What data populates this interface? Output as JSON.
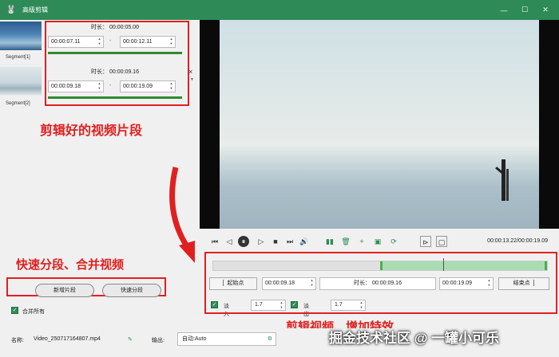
{
  "window": {
    "title": "高级剪辑",
    "app_icon": "rabbit-icon",
    "controls": [
      "minimize-icon",
      "maximize-icon",
      "close-icon"
    ]
  },
  "segments": [
    {
      "label": "Segment[1]",
      "duration_label": "时长：",
      "duration": "00:00:05.00",
      "start": "00:00:07.11",
      "end": "00:00:12.11",
      "separator": "-",
      "progress": 1.0
    },
    {
      "label": "Segment[2]",
      "duration_label": "时长：",
      "duration": "00:00:09.16",
      "start": "00:00:09.18",
      "end": "00:00:19.09",
      "separator": "-",
      "progress": 1.0
    }
  ],
  "segment_close": "×",
  "actions": {
    "add_segment": "新增片段",
    "quick_split": "快速分段",
    "merge_all_label": "合并所有",
    "merge_all_checked": true
  },
  "player": {
    "time_current": "00:00:13.22",
    "time_total": "00:00:19.09",
    "time_separator": "/",
    "controls": [
      "skip-start-icon",
      "step-back-icon",
      "pause-icon",
      "step-forward-icon",
      "skip-end-icon",
      "volume-icon",
      "split-icon",
      "delete-icon",
      "add-icon",
      "copy-icon",
      "reset-icon",
      "crop-icon",
      "screenshot-icon"
    ]
  },
  "timeline": {
    "selection_start": 0.5,
    "selection_end": 1.0,
    "playhead": 0.69
  },
  "range": {
    "start_button": "起始点",
    "start_time": "00:00:09.18",
    "duration_label": "时长：",
    "duration": "00:00:09.16",
    "end_time": "00:00:19.09",
    "end_button": "结束点",
    "start_bracket": "[",
    "end_bracket": "]"
  },
  "fade": {
    "fade_in_label": "淡入",
    "fade_in_value": "1.7",
    "fade_in_checked": true,
    "fade_out_label": "淡出",
    "fade_out_value": "1.7",
    "fade_out_checked": true
  },
  "footer": {
    "name_label": "名称:",
    "name_value": "Video_250717164807.mp4",
    "output_label": "输出:",
    "output_value": "自动:Auto"
  },
  "annotations": {
    "segments": "剪辑好的视频片段",
    "split_merge": "快速分段、合并视频",
    "edit_effects": "剪辑视频、增加特效"
  },
  "watermark": "掘金技术社区 @ 一罐小可乐",
  "colors": {
    "titlebar": "#2e8b57",
    "annotation_red": "#e02020",
    "timeline_selection": "#a9dcb0",
    "progress_green": "#2e8b2e"
  }
}
